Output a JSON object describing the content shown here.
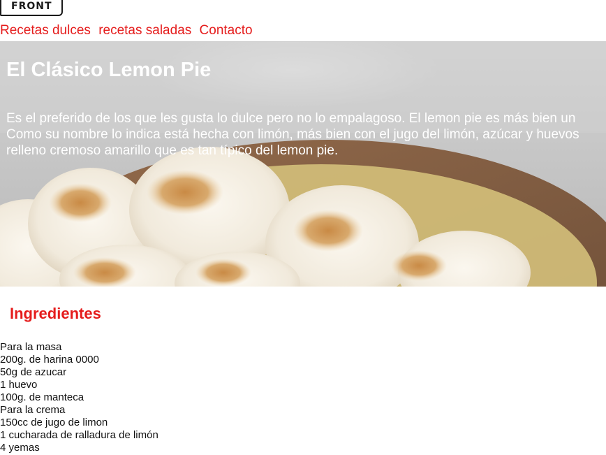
{
  "header": {
    "logo_text": "FRONT",
    "nav": [
      {
        "label": "Recetas dulces"
      },
      {
        "label": "recetas saladas"
      },
      {
        "label": "Contacto"
      }
    ]
  },
  "hero": {
    "title": "El Clásico Lemon Pie",
    "text_lines": [
      "Es el preferido de los que les gusta lo dulce pero no lo empalagoso. El lemon pie es más bien un",
      "Como su nombre lo indica está hecha con limón, más bien con el jugo del limón, azúcar y huevos",
      "relleno cremoso amarillo que es tan típico del lemon pie."
    ]
  },
  "ingredients": {
    "title": "Ingredientes",
    "items": [
      "Para la masa",
      "200g. de harina 0000",
      "50g de azucar",
      "1 huevo",
      "100g. de manteca",
      "Para la crema",
      "150cc de jugo de limon",
      "1 cucharada de ralladura de limón",
      "4 yemas"
    ]
  },
  "colors": {
    "accent": "#e51c1c",
    "text": "#111111",
    "hero_text": "#ffffff"
  }
}
